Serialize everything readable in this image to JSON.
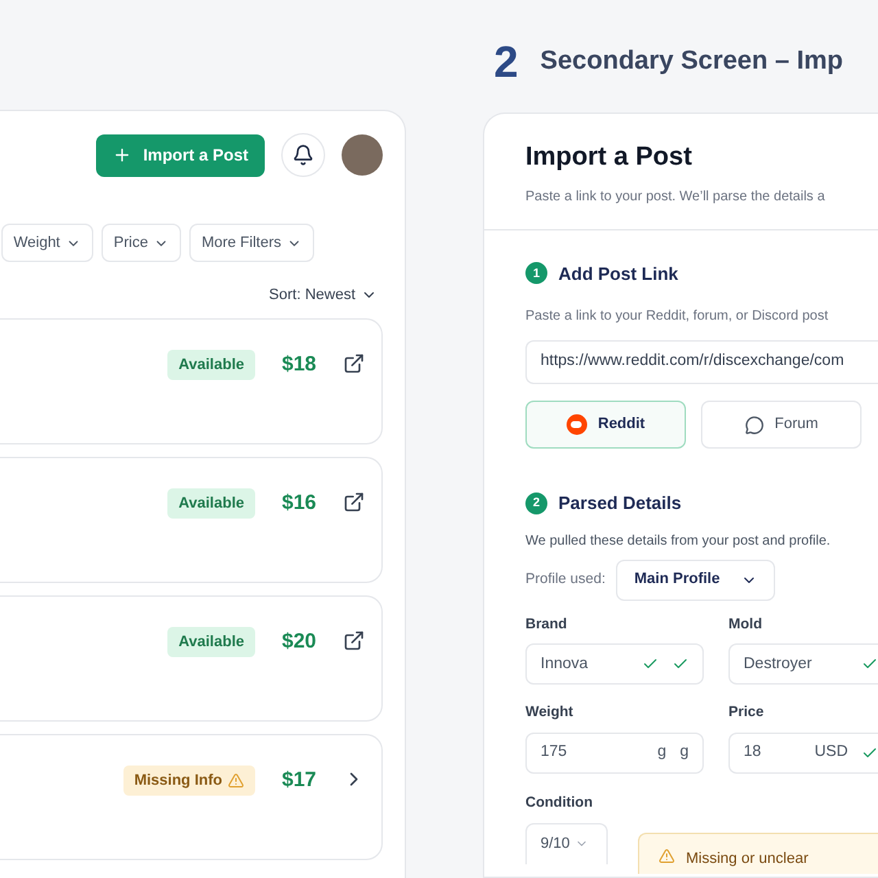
{
  "left_panel": {
    "import_button": "Import a Post",
    "filters": [
      "Weight",
      "Price",
      "More Filters"
    ],
    "sort": "Sort: Newest",
    "listings": [
      {
        "kind": "external",
        "status": {
          "kind": "available",
          "label": "Available"
        },
        "price": "$18"
      },
      {
        "kind": "external",
        "status": {
          "kind": "available",
          "label": "Available"
        },
        "price": "$16"
      },
      {
        "kind": "external",
        "status": {
          "kind": "available",
          "label": "Available"
        },
        "price": "$20"
      },
      {
        "kind": "chevron",
        "status": {
          "kind": "missing",
          "label": "Missing Info"
        },
        "price": "$17"
      }
    ]
  },
  "right_panel": {
    "step_number": "2",
    "heading": "Secondary Screen – Imp",
    "card": {
      "title": "Import a Post",
      "subtitle": "Paste a link to your post. We’ll parse the details a",
      "step1": {
        "number": "1",
        "title": "Add Post Link",
        "description": "Paste a link to your Reddit, forum, or Discord post",
        "url": "https://www.reddit.com/r/discexchange/com",
        "platforms": [
          {
            "kind": "reddit",
            "label": "Reddit",
            "selected": true
          },
          {
            "kind": "forum",
            "label": "Forum",
            "selected": false
          }
        ]
      },
      "step2": {
        "number": "2",
        "title": "Parsed Details",
        "description": "We pulled these details from your post and profile.",
        "profile_label": "Profile used:",
        "profile": "Main Profile",
        "fields": [
          {
            "label": "Brand",
            "value": "Innova",
            "verified": true
          },
          {
            "label": "Mold",
            "value": "Destroyer",
            "verified": true
          },
          {
            "label": "Weight",
            "value": "175",
            "suffixes": [
              "g",
              "g"
            ],
            "verified": false
          },
          {
            "label": "Price",
            "value": "18",
            "suffixes": [
              "USD"
            ],
            "verified": true
          }
        ],
        "condition_label": "Condition",
        "condition": "9/10",
        "alert": "Missing or unclear"
      }
    }
  }
}
